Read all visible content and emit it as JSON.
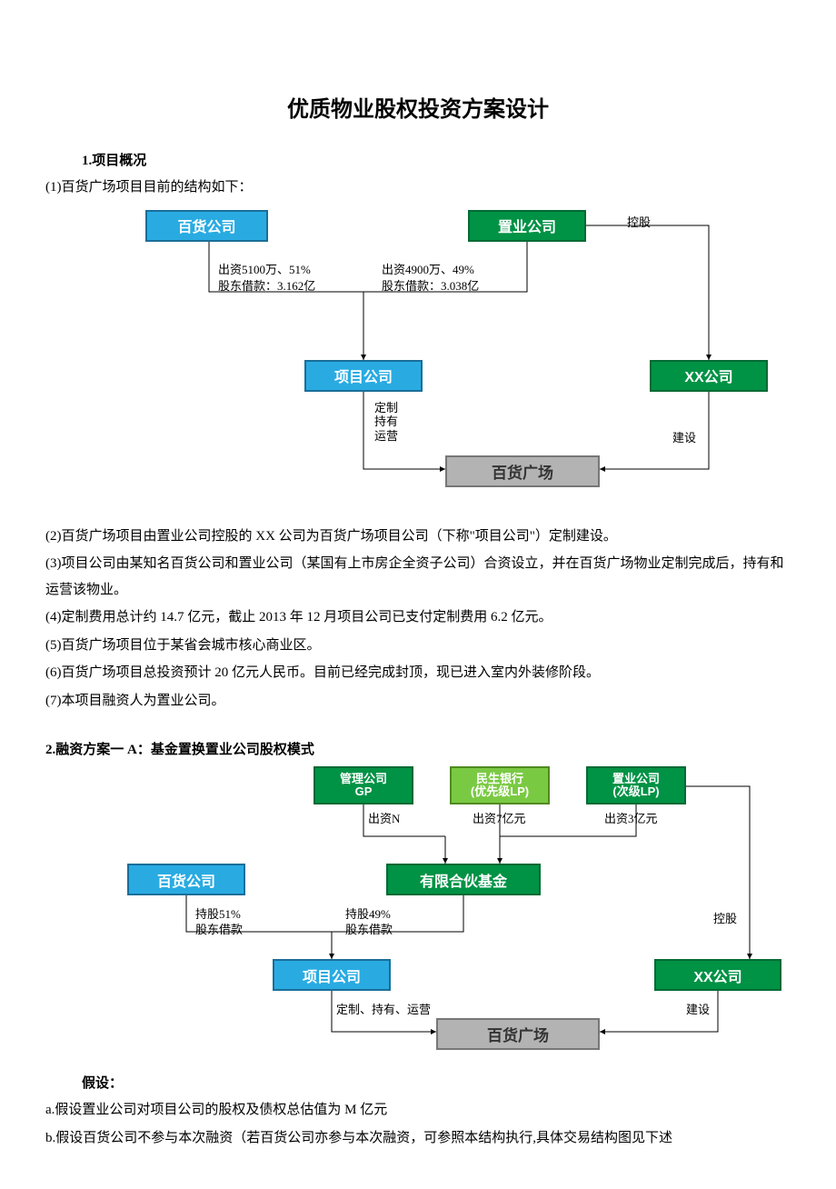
{
  "title": "优质物业股权投资方案设计",
  "section1_heading": "1.项目概况",
  "p1": "(1)百货广场项目目前的结构如下：",
  "diagram1": {
    "baihuo_gongsi": "百货公司",
    "zhiye_gongsi": "置业公司",
    "xiangmu_gongsi": "项目公司",
    "xx_gongsi": "XX公司",
    "baihuo_guangchang": "百货广场",
    "left_contrib_line1": "出资5100万、51%",
    "left_contrib_line2": "股东借款：3.162亿",
    "right_contrib_line1": "出资4900万、49%",
    "right_contrib_line2": "股东借款：3.038亿",
    "konggu": "控股",
    "dingzhi": "定制",
    "chiyou": "持有",
    "yunying": "运营",
    "jianshe": "建设"
  },
  "p2": "(2)百货广场项目由置业公司控股的 XX 公司为百货广场项目公司（下称\"项目公司\"）定制建设。",
  "p3": "(3)项目公司由某知名百货公司和置业公司（某国有上市房企全资子公司）合资设立，并在百货广场物业定制完成后，持有和运营该物业。",
  "p4": "(4)定制费用总计约 14.7 亿元，截止 2013 年 12 月项目公司已支付定制费用 6.2 亿元。",
  "p5": "(5)百货广场项目位于某省会城市核心商业区。",
  "p6": "(6)百货广场项目总投资预计 20 亿元人民币。目前已经完成封顶，现已进入室内外装修阶段。",
  "p7": "(7)本项目融资人为置业公司。",
  "section2_heading": "2.融资方案一 A：基金置换置业公司股权模式",
  "diagram2": {
    "guanli_gp_l1": "管理公司",
    "guanli_gp_l2": "GP",
    "minsheng_l1": "民生银行",
    "minsheng_l2": "(优先级LP)",
    "zhiye_l1": "置业公司",
    "zhiye_l2": "(次级LP)",
    "baihuo_gongsi": "百货公司",
    "youxian_hehuo": "有限合伙基金",
    "xiangmu_gongsi": "项目公司",
    "xx_gongsi": "XX公司",
    "baihuo_guangchang": "百货广场",
    "chuzi_n": "出资N",
    "chuzi_7": "出资7亿元",
    "chuzi_3": "出资3亿元",
    "chigu51": "持股51%",
    "gudong_jiekuan": "股东借款",
    "chigu49": "持股49%",
    "konggu": "控股",
    "dingzhi_chiyou_yunying": "定制、持有、运营",
    "jianshe": "建设"
  },
  "assume_heading": "假设：",
  "pa": "a.假设置业公司对项目公司的股权及债权总估值为 M 亿元",
  "pb": "b.假设百货公司不参与本次融资（若百货公司亦参与本次融资，可参照本结构执行,具体交易结构图见下述"
}
